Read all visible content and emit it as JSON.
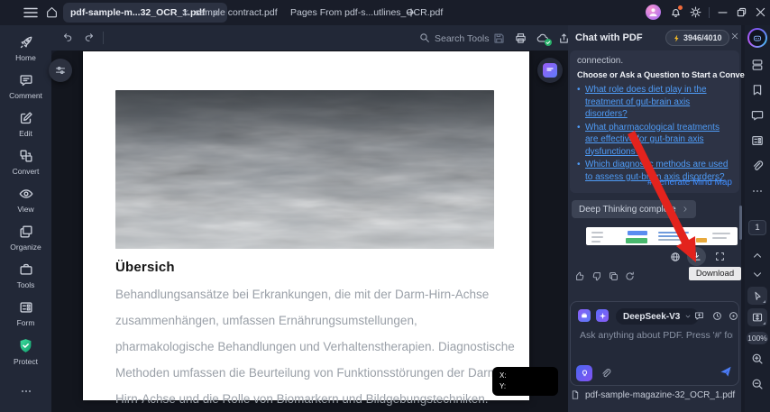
{
  "titlebar": {
    "tabs": [
      {
        "label": "pdf-sample-m...32_OCR_1.pdf",
        "active": true
      },
      {
        "label": "sample contract.pdf",
        "active": false
      },
      {
        "label": "Pages From pdf-s...utlines_OCR.pdf",
        "active": false
      }
    ]
  },
  "sidebar": {
    "items": [
      {
        "label": "Home"
      },
      {
        "label": "Comment"
      },
      {
        "label": "Edit"
      },
      {
        "label": "Convert"
      },
      {
        "label": "View"
      },
      {
        "label": "Organize"
      },
      {
        "label": "Tools"
      },
      {
        "label": "Form"
      },
      {
        "label": "Protect"
      }
    ]
  },
  "toolbar": {
    "search_label": "Search Tools"
  },
  "document": {
    "heading": "Übersich",
    "body": "Behandlungsansätze bei Erkrankungen, die mit der Darm-Hirn-Achse zusammenhängen, umfassen Ernährungsumstellungen, pharmakologische Behandlungen und Verhaltenstherapien. Diagnostische Methoden umfassen die Beurteilung von Funktionsstörungen der Darm-Hirn-Achse und die Rolle von Biomarkern und Bildgebungstechniken."
  },
  "chat": {
    "title": "Chat with PDF",
    "token_count": "3946/4010",
    "connection_text": "connection.",
    "prompt_heading": "Choose or Ask a Question to Start a Conversation",
    "questions": [
      "What role does diet play in the treatment of gut-brain axis disorders?",
      "What pharmacological treatments are effective for gut-brain axis dysfunctions?",
      "Which diagnostic methods are used to assess gut-brain axis disorders?"
    ],
    "mindmap_link": "#Generate Mind Map",
    "deep_thinking": "Deep Thinking complete",
    "download_tooltip": "Download",
    "model": "DeepSeek-V3",
    "input_placeholder": "Ask anything about PDF. Press '#' for Prompts.",
    "file_name": "pdf-sample-magazine-32_OCR_1.pdf"
  },
  "right_rail": {
    "page_number": "1",
    "zoom_level": "100%"
  },
  "coords_tooltip": {
    "x_label": "X:",
    "y_label": "Y:"
  },
  "colors": {
    "link_blue": "#4f9cf7",
    "accent_blue": "#4d7df5",
    "arrow_red": "#e3231d",
    "protect_green": "#2fbf8f",
    "token_yellow": "#f2b824",
    "panel_bg": "#262c3c"
  }
}
